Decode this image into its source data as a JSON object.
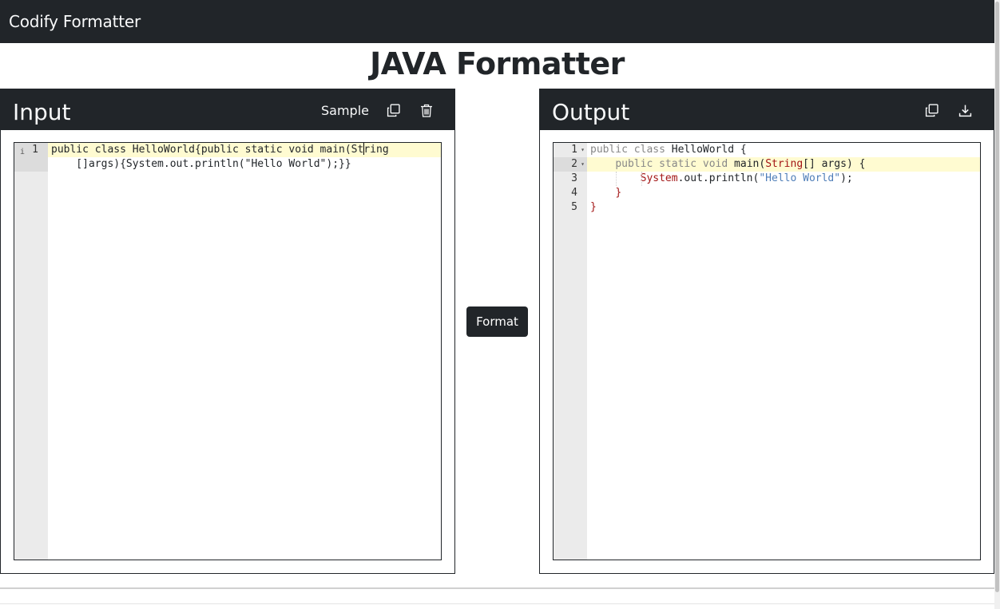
{
  "navbar": {
    "brand": "Codify Formatter"
  },
  "page": {
    "title": "JAVA Formatter"
  },
  "input_panel": {
    "title": "Input",
    "sample_label": "Sample",
    "copy_icon": "copy-icon",
    "delete_icon": "trash-icon",
    "editor": {
      "line_numbers": [
        "1"
      ],
      "line1_part1": "public class HelloWorld{public static void main(St",
      "line1_part2": "ring",
      "line1_wrap": "    []args){System.out.println(\"Hello World\");}}"
    }
  },
  "format_button": {
    "label": "Format"
  },
  "output_panel": {
    "title": "Output",
    "copy_icon": "copy-icon",
    "download_icon": "download-icon",
    "editor": {
      "line_numbers": [
        "1",
        "2",
        "3",
        "4",
        "5"
      ],
      "lines": [
        {
          "kw1": "public",
          "kw2": "class",
          "name": "HelloWorld",
          "rest": " {"
        },
        {
          "indent": "    ",
          "kw1": "public",
          "kw2": "static",
          "kw3": "void",
          "name": "main(",
          "type": "String",
          "rest": "[] args) {"
        },
        {
          "indent": "        ",
          "type": "System",
          "mid": ".out.println(",
          "str": "\"Hello World\"",
          "rest": ");"
        },
        {
          "indent": "    ",
          "rest": "}"
        },
        {
          "rest": "}"
        }
      ]
    }
  },
  "colors": {
    "dark": "#212529",
    "active_line": "#fffbd1",
    "gutter": "#ebebeb",
    "keyword": "#888888",
    "type": "#a31515",
    "string": "#4f7eb8"
  }
}
